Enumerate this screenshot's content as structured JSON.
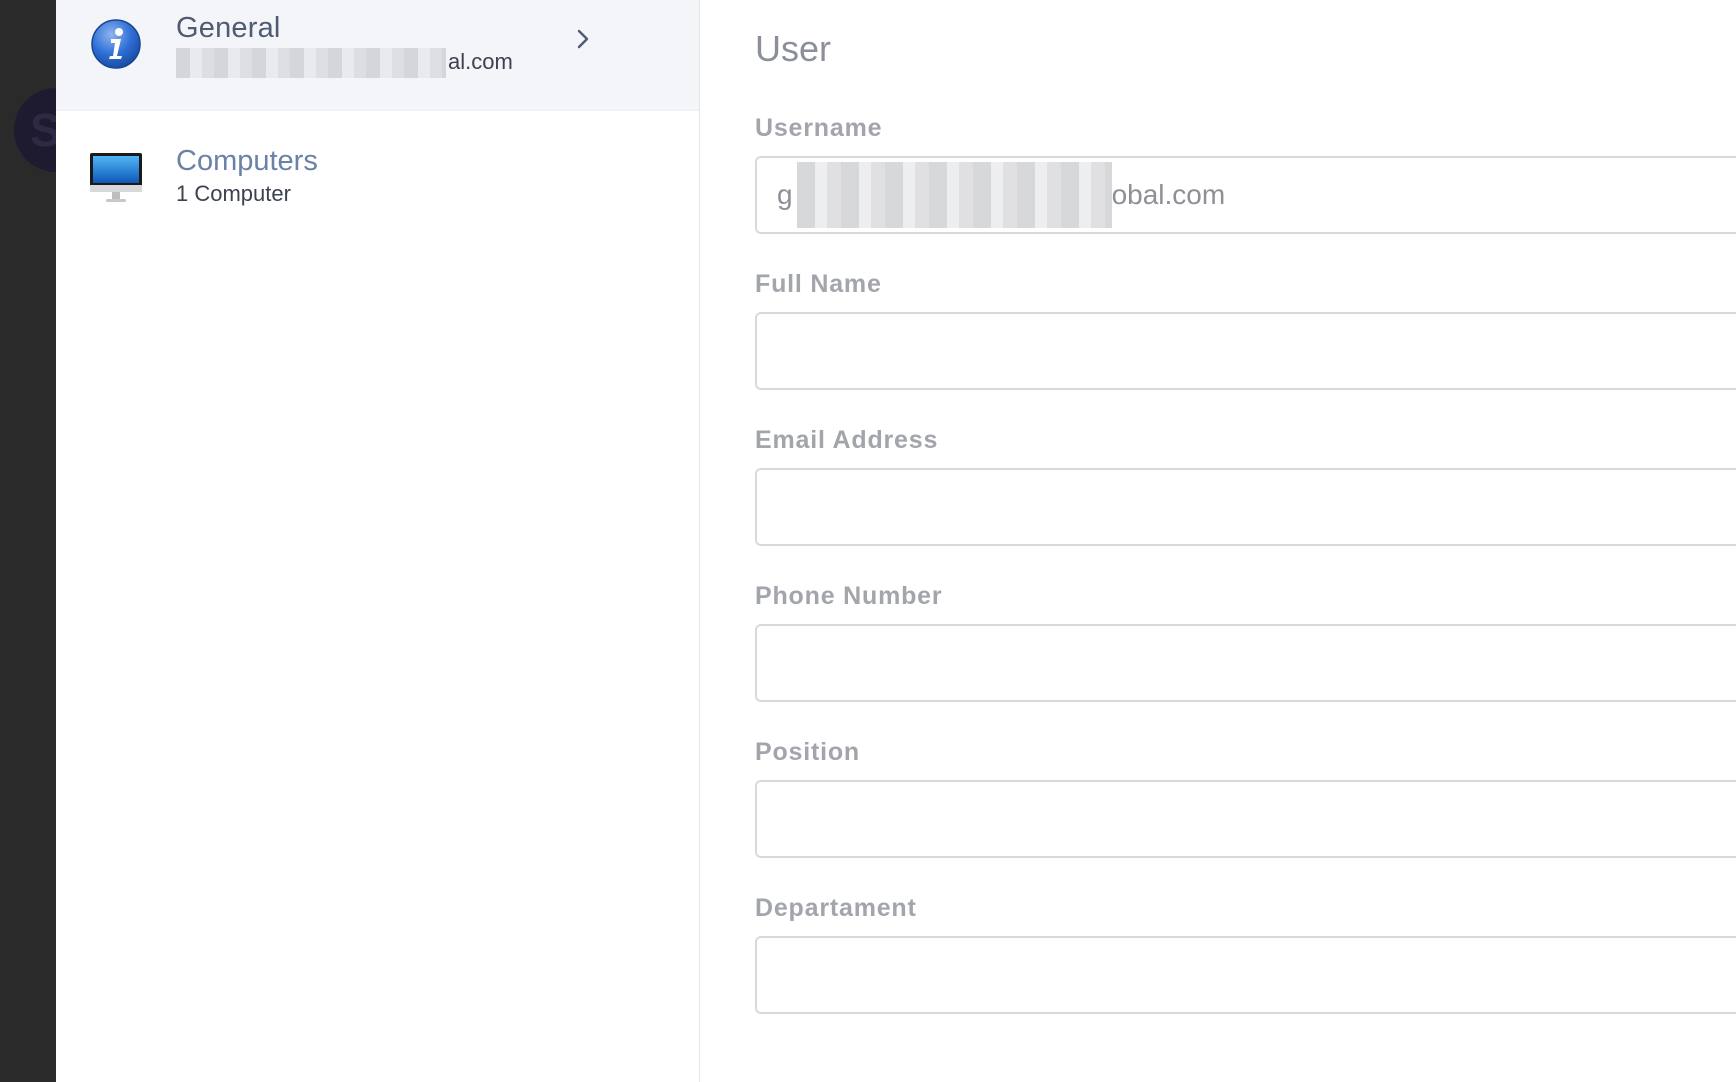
{
  "sidebar": {
    "items": [
      {
        "title": "General",
        "subtitle_suffix": "al.com",
        "icon": "info-icon",
        "active": true
      },
      {
        "title": "Computers",
        "subtitle": "1 Computer",
        "icon": "imac-icon"
      }
    ]
  },
  "main": {
    "section_title": "User",
    "fields": [
      {
        "label": "Username",
        "value_prefix": "g",
        "value_suffix": "obal.com"
      },
      {
        "label": "Full Name",
        "value": ""
      },
      {
        "label": "Email Address",
        "value": ""
      },
      {
        "label": "Phone Number",
        "value": ""
      },
      {
        "label": "Position",
        "value": ""
      },
      {
        "label": "Departament",
        "value": ""
      }
    ]
  },
  "colors": {
    "accent_link": "#6b82a8",
    "label_gray": "#a2a5ab",
    "active_bg": "#f4f5f9"
  }
}
